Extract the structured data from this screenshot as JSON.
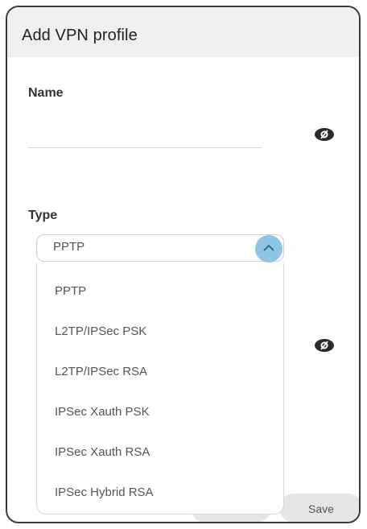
{
  "dialog": {
    "title": "Add VPN profile"
  },
  "name_field": {
    "label": "Name",
    "value": ""
  },
  "type_field": {
    "label": "Type",
    "selected": "PPTP",
    "options": [
      "PPTP",
      "L2TP/IPSec PSK",
      "L2TP/IPSec RSA",
      "IPSec Xauth PSK",
      "IPSec Xauth RSA",
      "IPSec Hybrid RSA"
    ]
  },
  "buttons": {
    "cancel": "",
    "save": "Save"
  },
  "icons": {
    "visibility": "eye-icon",
    "chevron": "chevron-up-icon"
  },
  "colors": {
    "chevron_bg": "#8cc6e3",
    "header_bg": "#f2f0ef"
  }
}
